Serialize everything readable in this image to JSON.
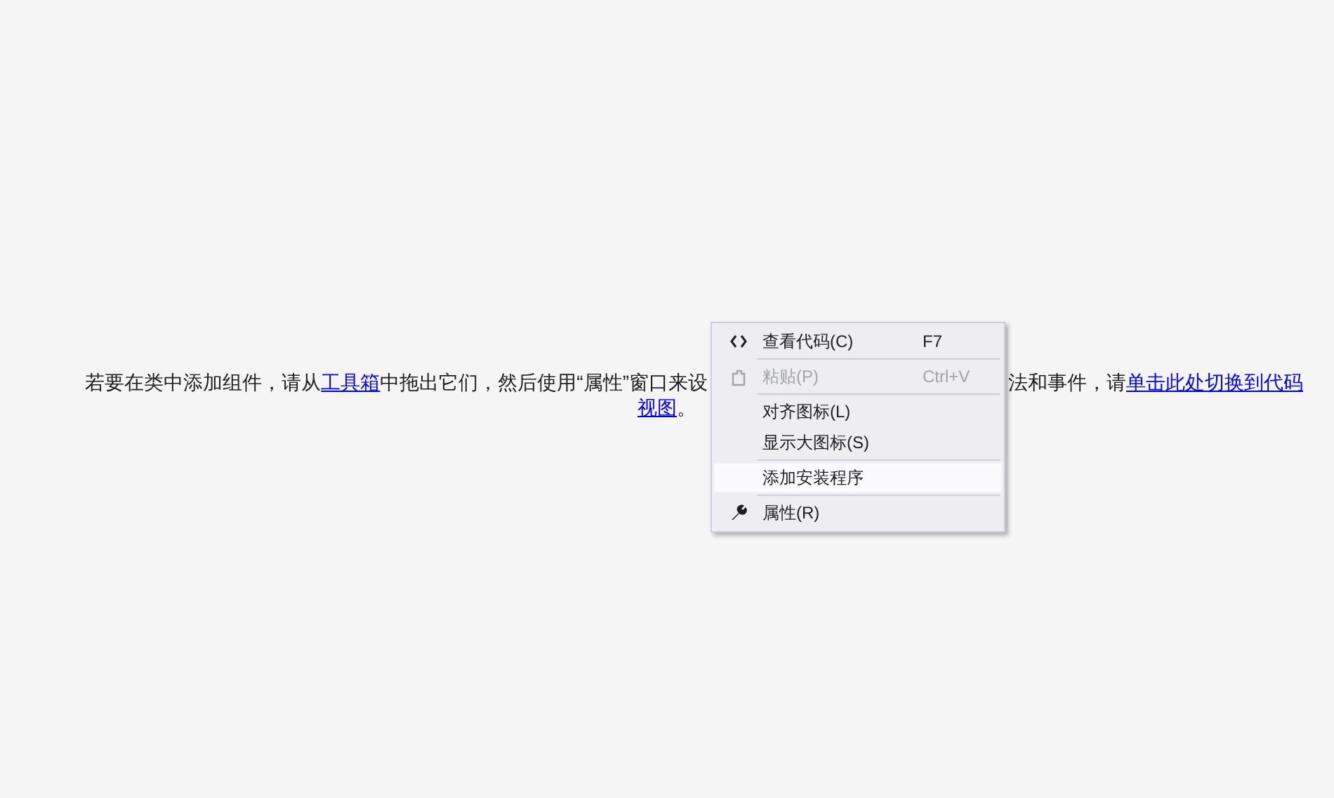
{
  "description": {
    "before_gap": [
      {
        "text": "若要在类中添加组件，请从",
        "link": false
      },
      {
        "text": "工具箱",
        "link": true
      },
      {
        "text": "中拖出它们，然后使用“属性”窗口来设",
        "link": false
      }
    ],
    "after_gap": [
      {
        "text": "法和事件，请",
        "link": false
      },
      {
        "text": "单击此处切换到代码",
        "link": true
      }
    ],
    "last_line": [
      {
        "text": "视图",
        "link": true
      },
      {
        "text": "。",
        "link": false
      }
    ]
  },
  "context_menu": [
    {
      "kind": "item",
      "label": "查看代码(C)",
      "shortcut": "F7",
      "disabled": false,
      "selected": false
    },
    {
      "kind": "separator"
    },
    {
      "kind": "item",
      "label": "粘贴(P)",
      "shortcut": "Ctrl+V",
      "disabled": true,
      "selected": false
    },
    {
      "kind": "separator"
    },
    {
      "kind": "item",
      "label": "对齐图标(L)",
      "disabled": false,
      "selected": false
    },
    {
      "kind": "item",
      "label": "显示大图标(S)",
      "disabled": false,
      "selected": false
    },
    {
      "kind": "separator"
    },
    {
      "kind": "item",
      "label": "添加安装程序",
      "disabled": false,
      "selected": true
    },
    {
      "kind": "separator"
    },
    {
      "kind": "item",
      "label": "属性(R)",
      "disabled": false,
      "selected": false
    }
  ]
}
